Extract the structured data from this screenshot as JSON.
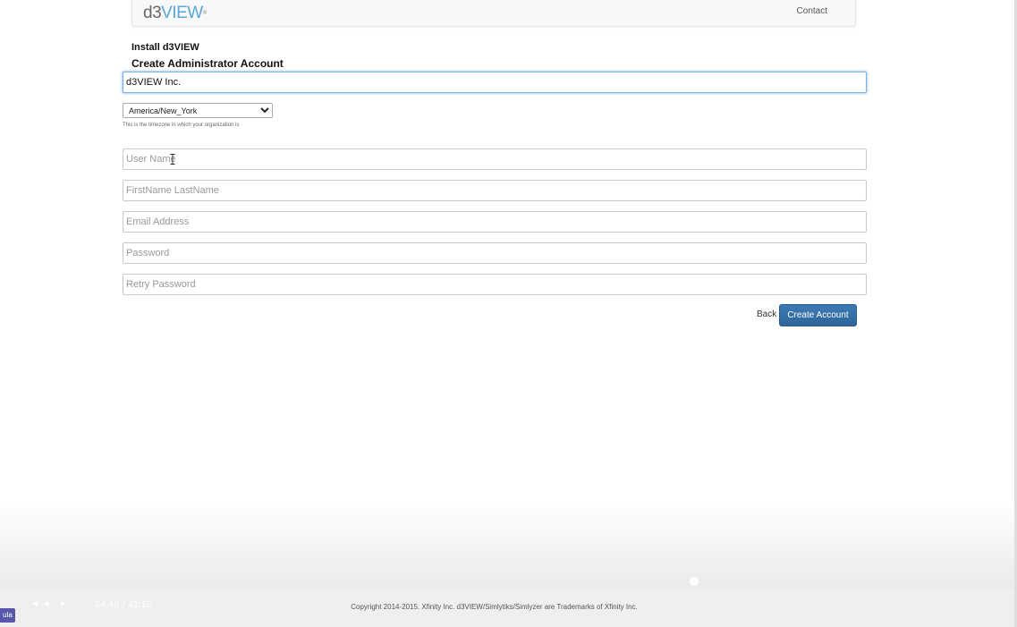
{
  "header": {
    "logo_prefix": "d3",
    "logo_suffix": "VIEW",
    "logo_mark": "®",
    "contact_label": "Contact"
  },
  "page": {
    "install_heading": "Install d3VIEW",
    "create_heading": "Create Administrator Account"
  },
  "form": {
    "organization_value": "d3VIEW Inc.",
    "timezone_selected": "America/New_York",
    "timezone_help": "This is the timezone in which your organization is",
    "username_placeholder": "User Name",
    "fullname_placeholder": "FirstName LastName",
    "email_placeholder": "Email Address",
    "password_placeholder": "Password",
    "retry_password_placeholder": "Retry Password",
    "back_label": "Back",
    "create_label": "Create Account"
  },
  "footer": {
    "copyright": "Copyright 2014-2015. Xfinity Inc. d3VIEW/Simlytiks/Simlyzer are Trademarks of Xfinity Inc."
  },
  "overlay": {
    "controls_glyphs": "◄◄ ►",
    "time": "24:46 / 41:10",
    "badge": "ula"
  }
}
